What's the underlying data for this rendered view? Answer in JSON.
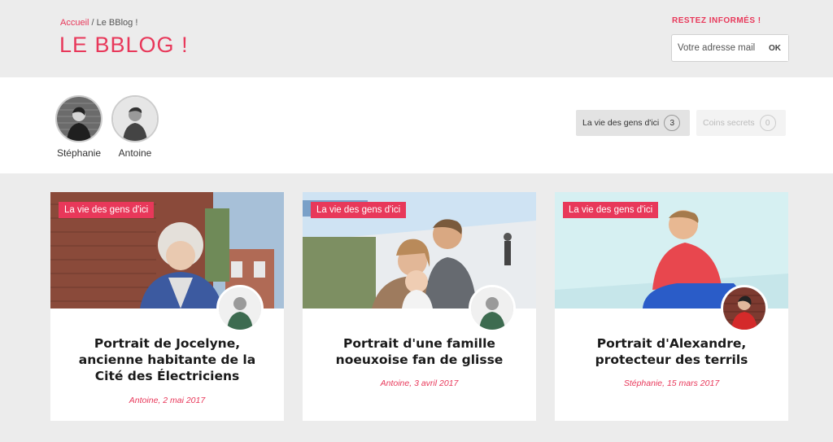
{
  "breadcrumb": {
    "home": "Accueil",
    "separator": " / ",
    "current": "Le BBlog !"
  },
  "page_title": "LE BBLOG !",
  "newsletter": {
    "title": "RESTEZ INFORMÉS !",
    "placeholder": "Votre adresse mail",
    "button": "OK"
  },
  "authors": [
    {
      "name": "Stéphanie"
    },
    {
      "name": "Antoine"
    }
  ],
  "filters": [
    {
      "label": "La vie des gens d'ici",
      "count": "3",
      "active": true
    },
    {
      "label": "Coins secrets",
      "count": "0",
      "active": false
    }
  ],
  "cards": [
    {
      "category": "La vie des gens d'ici",
      "title": "Portrait de Jocelyne, ancienne habitante de la Cité des Électriciens",
      "meta": "Antoine, 2 mai 2017",
      "author_icon": "author-antoine-avatar"
    },
    {
      "category": "La vie des gens d'ici",
      "title": "Portrait d'une famille noeuxoise fan de glisse",
      "meta": "Antoine, 3 avril 2017",
      "author_icon": "author-antoine-avatar"
    },
    {
      "category": "La vie des gens d'ici",
      "title": "Portrait d'Alexandre, protecteur des terrils",
      "meta": "Stéphanie, 15 mars 2017",
      "author_icon": "author-stephanie-avatar"
    }
  ],
  "colors": {
    "accent": "#e8385a",
    "header_bg": "#ececec",
    "card_bg": "#ffffff"
  }
}
